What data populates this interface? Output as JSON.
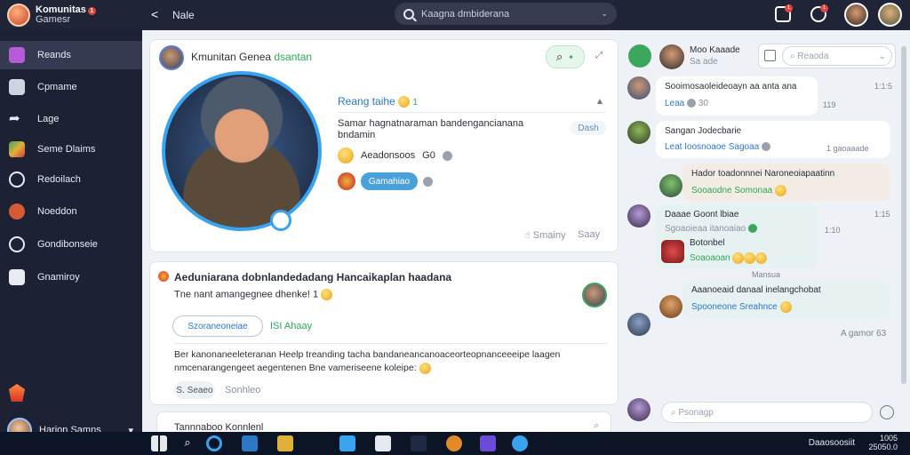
{
  "app": {
    "name": "Komunitas",
    "subtitle": "Gamesr",
    "badge": "1"
  },
  "topbar": {
    "back": "<",
    "page_title": "Nale",
    "search_text": "Kaagna dmbiderana",
    "search_chevron": "⌄",
    "notif_badge_1": "1",
    "notif_badge_2": "1"
  },
  "sidebar": {
    "items": [
      {
        "label": "Reands",
        "color": "#b85bd6"
      },
      {
        "label": "Cpmame",
        "color": "#cfd4e0"
      },
      {
        "label": "Lage",
        "color": "#e8ebf2"
      },
      {
        "label": "Seme Dlaims",
        "color": "#3ca55c"
      },
      {
        "label": "Redoilach",
        "color": "#e8ebf2"
      },
      {
        "label": "Noeddon",
        "color": "#d65a34"
      },
      {
        "label": "Gondibonseie",
        "color": "#e8ebf2"
      },
      {
        "label": "Gnamiroy",
        "color": "#e8ebf2"
      }
    ],
    "footer_name": "Harion Samns",
    "footer_chevron": "▾"
  },
  "post1": {
    "author": "Kmunitan Genea",
    "author_tag": "dsantan",
    "heading": "Reang taihe",
    "heading_count": "1",
    "desc_line1": "Samar hagnatnaraman bandengancianana",
    "desc_line2": "bndamin",
    "tag_pill": "Dash",
    "reaction_text": "Aeadonsoos",
    "reaction_count": "G0",
    "action_pill": "Gamahiao",
    "footer_left": "Smainy",
    "footer_right": "Saay"
  },
  "post2": {
    "title": "Aeduniarana dobnlandedadang Hancaikaplan haadana",
    "subtitle": "Tne nant amangegnee dhenke! 1",
    "link_pill": "Szoraneoneiae",
    "link_meta": "ISI Ahaay",
    "body_line1": "Ber kanonaneeleteranan  Heelp  treanding  tacha bandaneancanoaceorteopnanceeeipe laagen",
    "body_line2": "nmcenarangengeet aegentenen  Bne vameriseene koleipe:",
    "btn1": "S. Seaeo",
    "btn2": "Sonhleo"
  },
  "post3": {
    "title": "Tannnaboo Konnlenl"
  },
  "chat": {
    "header_name": "Moo Kaaade",
    "header_sub": "Sa ade",
    "filter_placeholder": "Reaoda",
    "messages": [
      {
        "line1": "Sooimosaoleideoayn aa anta ana",
        "line2": "Leaa",
        "count": "30",
        "time": "1:1:5",
        "time2": "119"
      },
      {
        "line1": "Sangan Jodecbarie",
        "line2": "Leat Ioosnoaoe Sagoaa",
        "time": "1 gaoaaade"
      },
      {
        "line1": "Hador toadonnnei Naroneoiapaatinn",
        "line2": "Sooaodne Somonaa",
        "time": ""
      },
      {
        "line1": "Daaae Goont lbiae",
        "line2": "Sgoaoieaa  itanoaiao",
        "line3": "Botonbel",
        "line4": "Soaoaoan",
        "time": "1:15",
        "time2": "1:10",
        "note": "Mansua"
      },
      {
        "line1": "Aaanoeaid danaal inelangchobat",
        "line2": "Spooneone  Sreahnce",
        "time": ""
      }
    ],
    "footer_note": "A gamor 63",
    "input_placeholder": "Psonagp"
  },
  "taskbar": {
    "tray_text": "Daaosoosiit",
    "clock_time": "1005",
    "clock_date": "25050.0"
  }
}
